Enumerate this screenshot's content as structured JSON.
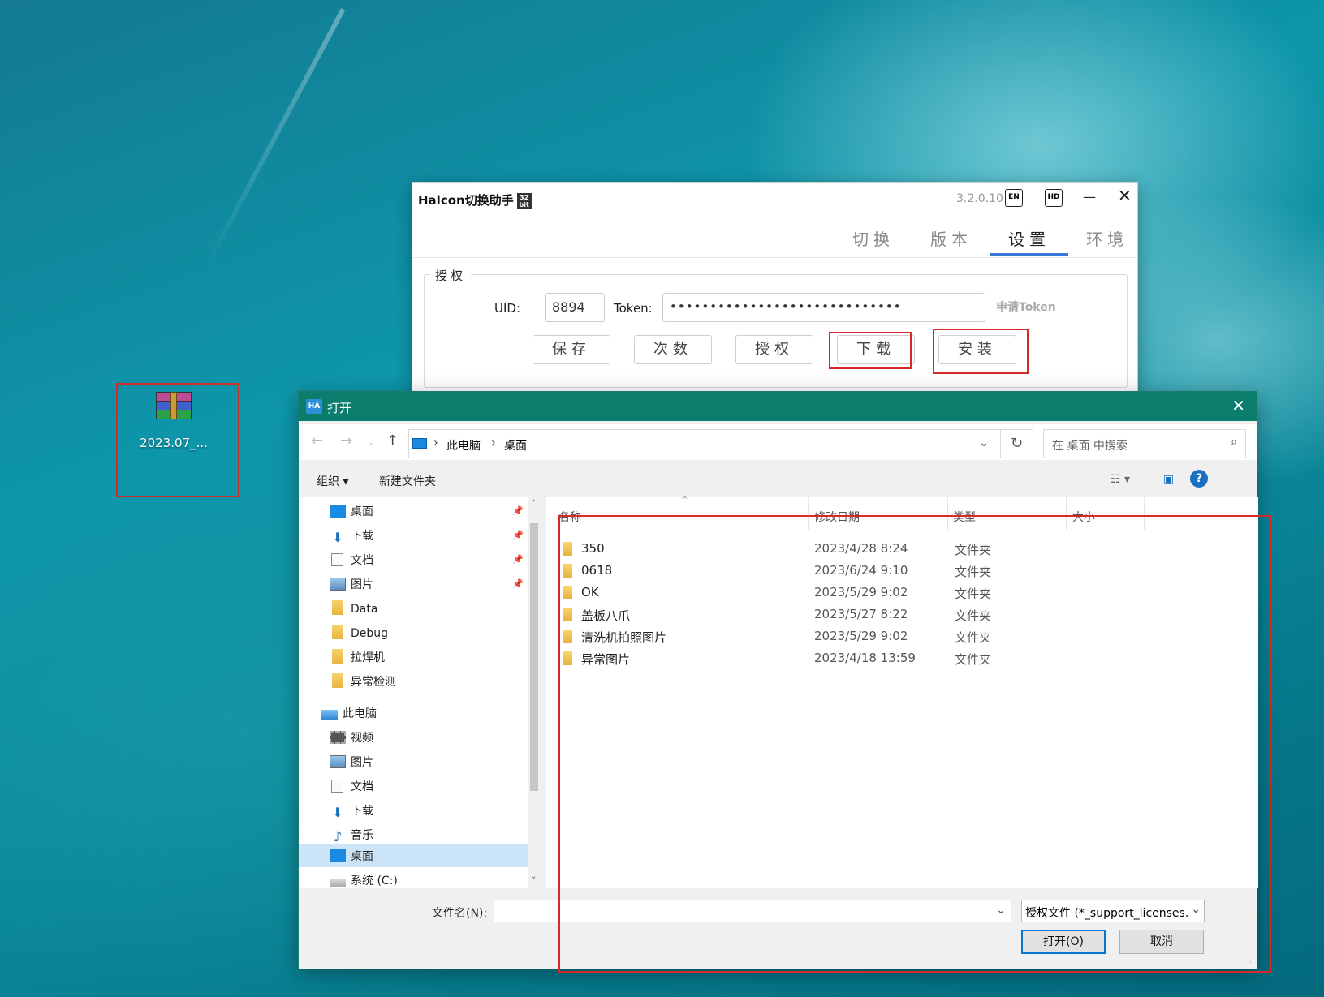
{
  "desktop": {
    "icon_label": "2023.07_..."
  },
  "halcon": {
    "title": "Halcon切换助手",
    "bit_badge": "32 bit",
    "version": "3.2.0.10",
    "en_button": "EN",
    "hd_button": "HD",
    "minimize": "—",
    "close": "✕",
    "tabs": [
      "切换",
      "版本",
      "设置",
      "环境"
    ],
    "active_tab": "设置",
    "group_label": "授权",
    "uid_label": "UID:",
    "uid_value": "8894",
    "token_label": "Token:",
    "token_value": "•••••••••••••••••••••••••••••",
    "apply_token_link": "申请Token",
    "buttons": [
      "保存",
      "次数",
      "授权",
      "下载",
      "安装"
    ]
  },
  "dialog": {
    "title": "打开",
    "close": "✕",
    "breadcrumb": [
      "此电脑",
      "桌面"
    ],
    "search_placeholder": "在 桌面 中搜索",
    "organize": "组织 ▾",
    "new_folder": "新建文件夹",
    "help": "?",
    "nav_items": [
      {
        "label": "桌面",
        "icon": "desktop-icon",
        "pinned": true
      },
      {
        "label": "下载",
        "icon": "download-icon",
        "pinned": true
      },
      {
        "label": "文档",
        "icon": "document-icon",
        "pinned": true
      },
      {
        "label": "图片",
        "icon": "picture-icon",
        "pinned": true
      },
      {
        "label": "Data",
        "icon": "folder-icon",
        "pinned": false
      },
      {
        "label": "Debug",
        "icon": "folder-icon",
        "pinned": false
      },
      {
        "label": "拉焊机",
        "icon": "folder-icon",
        "pinned": false
      },
      {
        "label": "异常检测",
        "icon": "folder-icon",
        "pinned": false
      },
      {
        "label": "此电脑",
        "icon": "computer-icon",
        "pinned": false
      },
      {
        "label": "视频",
        "icon": "video-icon",
        "pinned": false
      },
      {
        "label": "图片",
        "icon": "picture-icon",
        "pinned": false
      },
      {
        "label": "文档",
        "icon": "document-icon",
        "pinned": false
      },
      {
        "label": "下载",
        "icon": "download-icon",
        "pinned": false
      },
      {
        "label": "音乐",
        "icon": "music-icon",
        "pinned": false
      },
      {
        "label": "桌面",
        "icon": "desktop-icon",
        "pinned": false
      },
      {
        "label": "系统 (C:)",
        "icon": "drive-icon",
        "pinned": false
      }
    ],
    "columns": [
      "名称",
      "修改日期",
      "类型",
      "大小"
    ],
    "files": [
      {
        "name": "350",
        "date": "2023/4/28 8:24",
        "type": "文件夹"
      },
      {
        "name": "0618",
        "date": "2023/6/24 9:10",
        "type": "文件夹"
      },
      {
        "name": "OK",
        "date": "2023/5/29 9:02",
        "type": "文件夹"
      },
      {
        "name": "盖板八爪",
        "date": "2023/5/27 8:22",
        "type": "文件夹"
      },
      {
        "name": "清洗机拍照图片",
        "date": "2023/5/29 9:02",
        "type": "文件夹"
      },
      {
        "name": "异常图片",
        "date": "2023/4/18 13:59",
        "type": "文件夹"
      }
    ],
    "filename_label": "文件名(N):",
    "filename_value": "",
    "file_type": "授权文件 (*_support_licenses.",
    "open_button": "打开(O)",
    "cancel_button": "取消"
  }
}
